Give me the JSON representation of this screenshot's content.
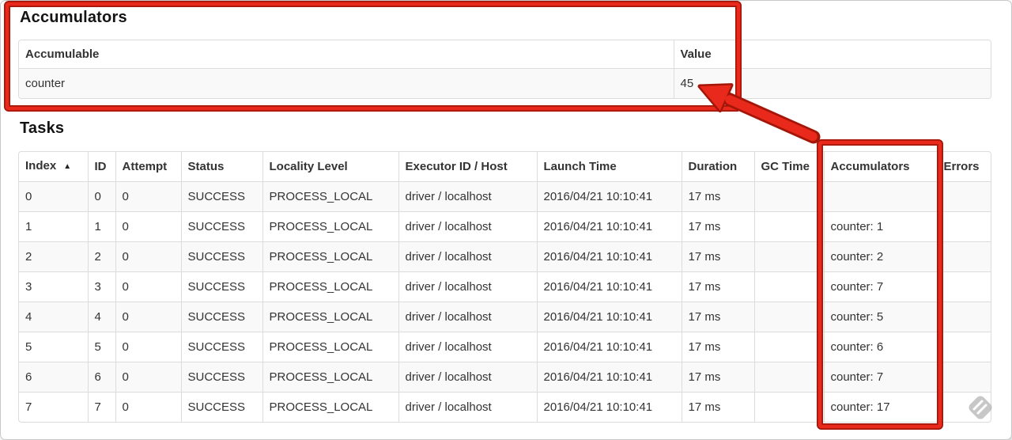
{
  "accumulators_section": {
    "title": "Accumulators",
    "table": {
      "headers": [
        "Accumulable",
        "Value"
      ],
      "rows": [
        {
          "accumulable": "counter",
          "value": "45"
        }
      ]
    }
  },
  "tasks_section": {
    "title": "Tasks",
    "table": {
      "headers": [
        "Index",
        "ID",
        "Attempt",
        "Status",
        "Locality Level",
        "Executor ID / Host",
        "Launch Time",
        "Duration",
        "GC Time",
        "Accumulators",
        "Errors"
      ],
      "rows": [
        {
          "index": "0",
          "id": "0",
          "attempt": "0",
          "status": "SUCCESS",
          "locality_level": "PROCESS_LOCAL",
          "executor_id_host": "driver / localhost",
          "launch_time": "2016/04/21 10:10:41",
          "duration": "17 ms",
          "gc_time": "",
          "accumulators": "",
          "errors": ""
        },
        {
          "index": "1",
          "id": "1",
          "attempt": "0",
          "status": "SUCCESS",
          "locality_level": "PROCESS_LOCAL",
          "executor_id_host": "driver / localhost",
          "launch_time": "2016/04/21 10:10:41",
          "duration": "17 ms",
          "gc_time": "",
          "accumulators": "counter: 1",
          "errors": ""
        },
        {
          "index": "2",
          "id": "2",
          "attempt": "0",
          "status": "SUCCESS",
          "locality_level": "PROCESS_LOCAL",
          "executor_id_host": "driver / localhost",
          "launch_time": "2016/04/21 10:10:41",
          "duration": "17 ms",
          "gc_time": "",
          "accumulators": "counter: 2",
          "errors": ""
        },
        {
          "index": "3",
          "id": "3",
          "attempt": "0",
          "status": "SUCCESS",
          "locality_level": "PROCESS_LOCAL",
          "executor_id_host": "driver / localhost",
          "launch_time": "2016/04/21 10:10:41",
          "duration": "17 ms",
          "gc_time": "",
          "accumulators": "counter: 7",
          "errors": ""
        },
        {
          "index": "4",
          "id": "4",
          "attempt": "0",
          "status": "SUCCESS",
          "locality_level": "PROCESS_LOCAL",
          "executor_id_host": "driver / localhost",
          "launch_time": "2016/04/21 10:10:41",
          "duration": "17 ms",
          "gc_time": "",
          "accumulators": "counter: 5",
          "errors": ""
        },
        {
          "index": "5",
          "id": "5",
          "attempt": "0",
          "status": "SUCCESS",
          "locality_level": "PROCESS_LOCAL",
          "executor_id_host": "driver / localhost",
          "launch_time": "2016/04/21 10:10:41",
          "duration": "17 ms",
          "gc_time": "",
          "accumulators": "counter: 6",
          "errors": ""
        },
        {
          "index": "6",
          "id": "6",
          "attempt": "0",
          "status": "SUCCESS",
          "locality_level": "PROCESS_LOCAL",
          "executor_id_host": "driver / localhost",
          "launch_time": "2016/04/21 10:10:41",
          "duration": "17 ms",
          "gc_time": "",
          "accumulators": "counter: 7",
          "errors": ""
        },
        {
          "index": "7",
          "id": "7",
          "attempt": "0",
          "status": "SUCCESS",
          "locality_level": "PROCESS_LOCAL",
          "executor_id_host": "driver / localhost",
          "launch_time": "2016/04/21 10:10:41",
          "duration": "17 ms",
          "gc_time": "",
          "accumulators": "counter: 17",
          "errors": ""
        }
      ]
    }
  },
  "annotations": {
    "highlight_color": "#e8291c",
    "outline_color": "#a31608"
  },
  "icons": {
    "sort_ascending_icon": "▲",
    "watermark_icon": "diamond-with-stripes"
  }
}
